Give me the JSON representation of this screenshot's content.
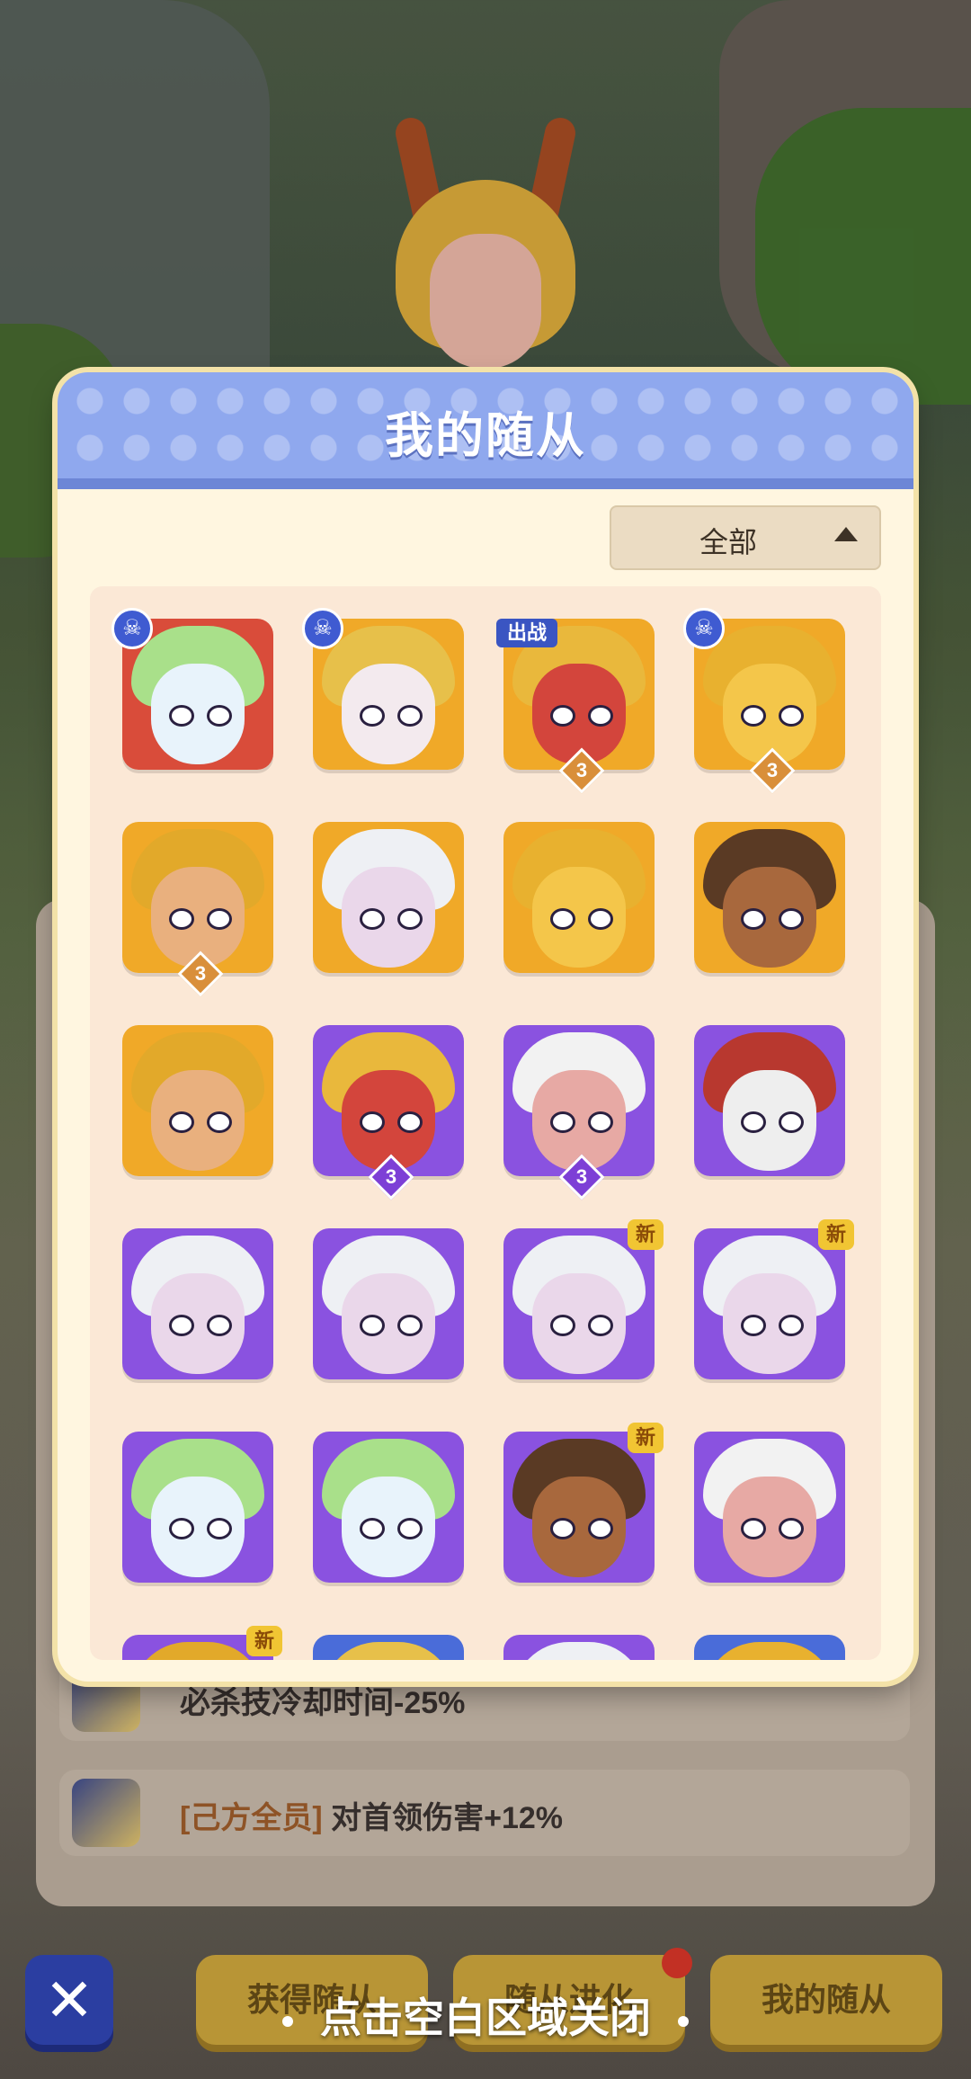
{
  "modal": {
    "title": "我的随从",
    "filter": {
      "label": "全部",
      "icon": "triangle-up-icon"
    }
  },
  "followers": [
    {
      "char": "unicorn",
      "bg": "red",
      "badge": "skull"
    },
    {
      "char": "harley",
      "bg": "orange",
      "badge": "skull"
    },
    {
      "char": "demon-girl",
      "bg": "orange",
      "badge": "deploy",
      "level": "3"
    },
    {
      "char": "duck",
      "bg": "orange",
      "badge": "skull",
      "level": "3"
    },
    {
      "char": "golden-hero",
      "bg": "orange",
      "level": "3"
    },
    {
      "char": "silver-vampire",
      "bg": "orange"
    },
    {
      "char": "duck",
      "bg": "orange"
    },
    {
      "char": "braided-warrior",
      "bg": "orange"
    },
    {
      "char": "golden-hero",
      "bg": "orange"
    },
    {
      "char": "demon-girl",
      "bg": "purple",
      "level": "3"
    },
    {
      "char": "snail",
      "bg": "purple",
      "level": "3"
    },
    {
      "char": "soldier",
      "bg": "purple"
    },
    {
      "char": "silver-vampire",
      "bg": "purple"
    },
    {
      "char": "silver-vampire",
      "bg": "purple"
    },
    {
      "char": "silver-vampire",
      "bg": "purple",
      "badge": "new"
    },
    {
      "char": "silver-vampire",
      "bg": "purple",
      "badge": "new"
    },
    {
      "char": "unicorn",
      "bg": "purple"
    },
    {
      "char": "unicorn",
      "bg": "purple"
    },
    {
      "char": "braided-warrior",
      "bg": "purple",
      "badge": "new"
    },
    {
      "char": "snail",
      "bg": "purple"
    },
    {
      "char": "golden-hero",
      "bg": "purple",
      "badge": "new"
    },
    {
      "char": "harley",
      "bg": "blue"
    },
    {
      "char": "silver-vampire",
      "bg": "purple"
    },
    {
      "char": "duck",
      "bg": "blue"
    }
  ],
  "badge_text": {
    "deploy": "出战",
    "new": "新"
  },
  "background": {
    "buffs": [
      {
        "tag": "",
        "text": "必杀技冷却时间-25%"
      },
      {
        "tag": "[己方全员]",
        "text": " 对首领伤害+12%"
      }
    ],
    "buttons": [
      "获得随从",
      "随从进化",
      "我的随从"
    ]
  },
  "hint": "点击空白区域关闭",
  "colors": {
    "header": "#8fa8ee",
    "panel": "#fff6e0",
    "orange_bg": "#f0a928",
    "purple_bg": "#8a52e0",
    "red_bg": "#d94c3a",
    "blue_bg": "#4a6cd9"
  }
}
